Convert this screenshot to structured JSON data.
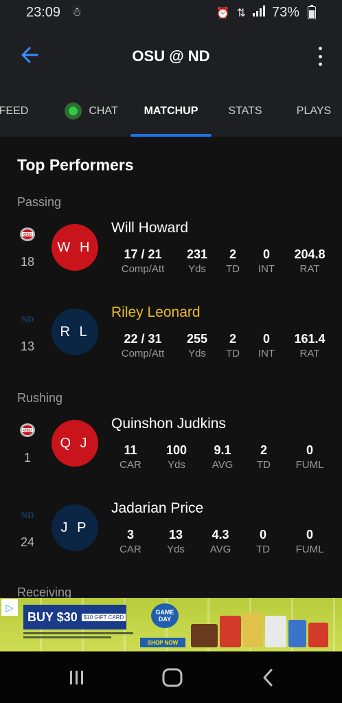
{
  "status_bar": {
    "time": "23:09",
    "battery": "73%"
  },
  "app_bar": {
    "title": "OSU @ ND"
  },
  "tabs": [
    {
      "label": "FEED"
    },
    {
      "label": "CHAT"
    },
    {
      "label": "MATCHUP",
      "active": true
    },
    {
      "label": "STATS"
    },
    {
      "label": "PLAYS"
    }
  ],
  "section_title": "Top Performers",
  "categories": {
    "passing": "Passing",
    "rushing": "Rushing",
    "receiving": "Receiving"
  },
  "players": [
    {
      "name": "Will Howard",
      "initials": "W H",
      "jersey": "18",
      "team": "OSU",
      "stats": [
        {
          "value": "17 / 21",
          "label": "Comp/Att"
        },
        {
          "value": "231",
          "label": "Yds"
        },
        {
          "value": "2",
          "label": "TD"
        },
        {
          "value": "0",
          "label": "INT"
        },
        {
          "value": "204.8",
          "label": "RAT"
        }
      ]
    },
    {
      "name": "Riley Leonard",
      "initials": "R L",
      "jersey": "13",
      "team": "ND",
      "stats": [
        {
          "value": "22 / 31",
          "label": "Comp/Att"
        },
        {
          "value": "255",
          "label": "Yds"
        },
        {
          "value": "2",
          "label": "TD"
        },
        {
          "value": "0",
          "label": "INT"
        },
        {
          "value": "161.4",
          "label": "RAT"
        }
      ]
    },
    {
      "name": "Quinshon Judkins",
      "initials": "Q J",
      "jersey": "1",
      "team": "OSU",
      "stats": [
        {
          "value": "11",
          "label": "CAR"
        },
        {
          "value": "100",
          "label": "Yds"
        },
        {
          "value": "9.1",
          "label": "AVG"
        },
        {
          "value": "2",
          "label": "TD"
        },
        {
          "value": "0",
          "label": "FUML"
        }
      ]
    },
    {
      "name": "Jadarian Price",
      "initials": "J P",
      "jersey": "24",
      "team": "ND",
      "stats": [
        {
          "value": "3",
          "label": "CAR"
        },
        {
          "value": "13",
          "label": "Yds"
        },
        {
          "value": "4.3",
          "label": "AVG"
        },
        {
          "value": "0",
          "label": "TD"
        },
        {
          "value": "0",
          "label": "FUML"
        }
      ]
    }
  ],
  "ad": {
    "headline": "BUY $30",
    "gift": "$10 GIFT CARD",
    "gameday": "GAME DAY",
    "shop": "SHOP NOW"
  },
  "colors": {
    "accent": "#1a73e8",
    "osu_red": "#c8141a",
    "nd_navy": "#0b2545",
    "highlight_gold": "#e8b92b"
  }
}
